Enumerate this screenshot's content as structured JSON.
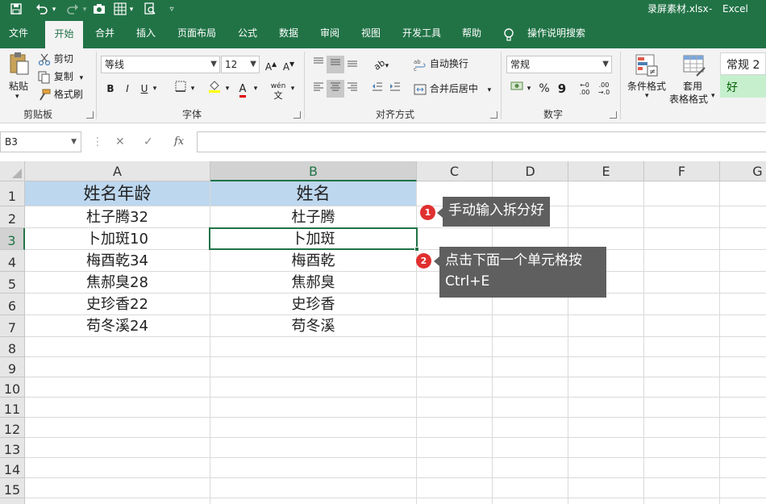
{
  "titlebar": {
    "filename": "录屏素材.xlsx",
    "app_name": "Excel",
    "qat": [
      "save-icon",
      "undo-icon",
      "redo-icon",
      "camera-icon",
      "grid-icon",
      "print-preview-icon",
      "customize-qat-icon"
    ]
  },
  "tabs": [
    {
      "label": "文件",
      "active": false
    },
    {
      "label": "开始",
      "active": true
    },
    {
      "label": "合并",
      "active": false
    },
    {
      "label": "插入",
      "active": false
    },
    {
      "label": "页面布局",
      "active": false
    },
    {
      "label": "公式",
      "active": false
    },
    {
      "label": "数据",
      "active": false
    },
    {
      "label": "审阅",
      "active": false
    },
    {
      "label": "视图",
      "active": false
    },
    {
      "label": "开发工具",
      "active": false
    },
    {
      "label": "帮助",
      "active": false
    },
    {
      "label": "操作说明搜索",
      "active": false
    }
  ],
  "ribbon": {
    "clipboard": {
      "paste": "粘贴",
      "cut": "剪切",
      "copy": "复制",
      "format_painter": "格式刷",
      "group": "剪贴板"
    },
    "font": {
      "name": "等线",
      "size": "12",
      "bold": "B",
      "italic": "I",
      "underline": "U",
      "pinyin": "wén",
      "group": "字体"
    },
    "alignment": {
      "wrap": "自动换行",
      "merge": "合并后居中",
      "group": "对齐方式"
    },
    "number": {
      "format": "常规",
      "percent": "%",
      "comma": "9",
      "group": "数字"
    },
    "styles": {
      "conditional": "条件格式",
      "table_format_1": "套用",
      "table_format_2": "表格格式",
      "style_normal": "常规 2",
      "style_good": "好"
    }
  },
  "formula_bar": {
    "name_box": "B3",
    "cancel": "✕",
    "enter": "✓",
    "fx": "fx",
    "content": ""
  },
  "columns": [
    "A",
    "B",
    "C",
    "D",
    "E",
    "F",
    "G"
  ],
  "rows": [
    "1",
    "2",
    "3",
    "4",
    "5",
    "6",
    "7",
    "8",
    "9",
    "10",
    "11",
    "12",
    "13",
    "14",
    "15"
  ],
  "sheet": {
    "A": [
      "姓名年龄",
      "杜子腾32",
      "卜加斑10",
      "梅酉乾34",
      "焦郝臭28",
      "史珍香22",
      "苟冬溪24"
    ],
    "B": [
      "姓名",
      "杜子腾",
      "卜加斑",
      "梅酉乾",
      "焦郝臭",
      "史珍香",
      "苟冬溪"
    ]
  },
  "selected_cell": "B3",
  "callouts": [
    {
      "num": "1",
      "text": "手动输入拆分好"
    },
    {
      "num": "2",
      "line1": "点击下面一个单元格按",
      "line2": "Ctrl+E"
    }
  ],
  "colors": {
    "excel_green": "#217346",
    "header_fill": "#bdd7ee",
    "badge_red": "#e0302f",
    "callout_bg": "#5f5f5f"
  }
}
